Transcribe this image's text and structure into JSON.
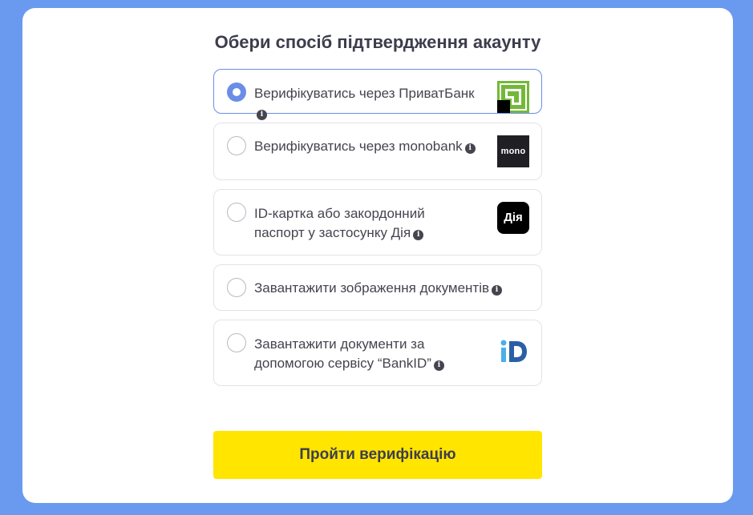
{
  "page": {
    "title": "Обери спосіб підтвердження акаунту"
  },
  "options": [
    {
      "id": "privatbank",
      "line1": "Верифікуватись через ПриватБанк",
      "line2": "",
      "selected": true,
      "logo": "privatbank-logo"
    },
    {
      "id": "monobank",
      "line1": "Верифікуватись через monobank",
      "line2": "",
      "selected": false,
      "logo_text": "mono"
    },
    {
      "id": "diia",
      "line1": "ID-картка або закордонний",
      "line2": "паспорт у застосунку Дія",
      "selected": false,
      "logo_text": "Дія"
    },
    {
      "id": "upload-images",
      "line1": "Завантажити зображення документів",
      "line2": "",
      "selected": false
    },
    {
      "id": "bankid",
      "line1": "Завантажити документи за",
      "line2": "допомогою сервісу “BankID”",
      "selected": false,
      "logo": "bankid-logo"
    }
  ],
  "info_glyph": "i",
  "colors": {
    "background": "#6a9af0",
    "accent": "#6a8ee6",
    "button": "#ffe500",
    "privatbank_green": "#74b83a"
  },
  "verify_button": {
    "label": "Пройти верифікацію"
  }
}
